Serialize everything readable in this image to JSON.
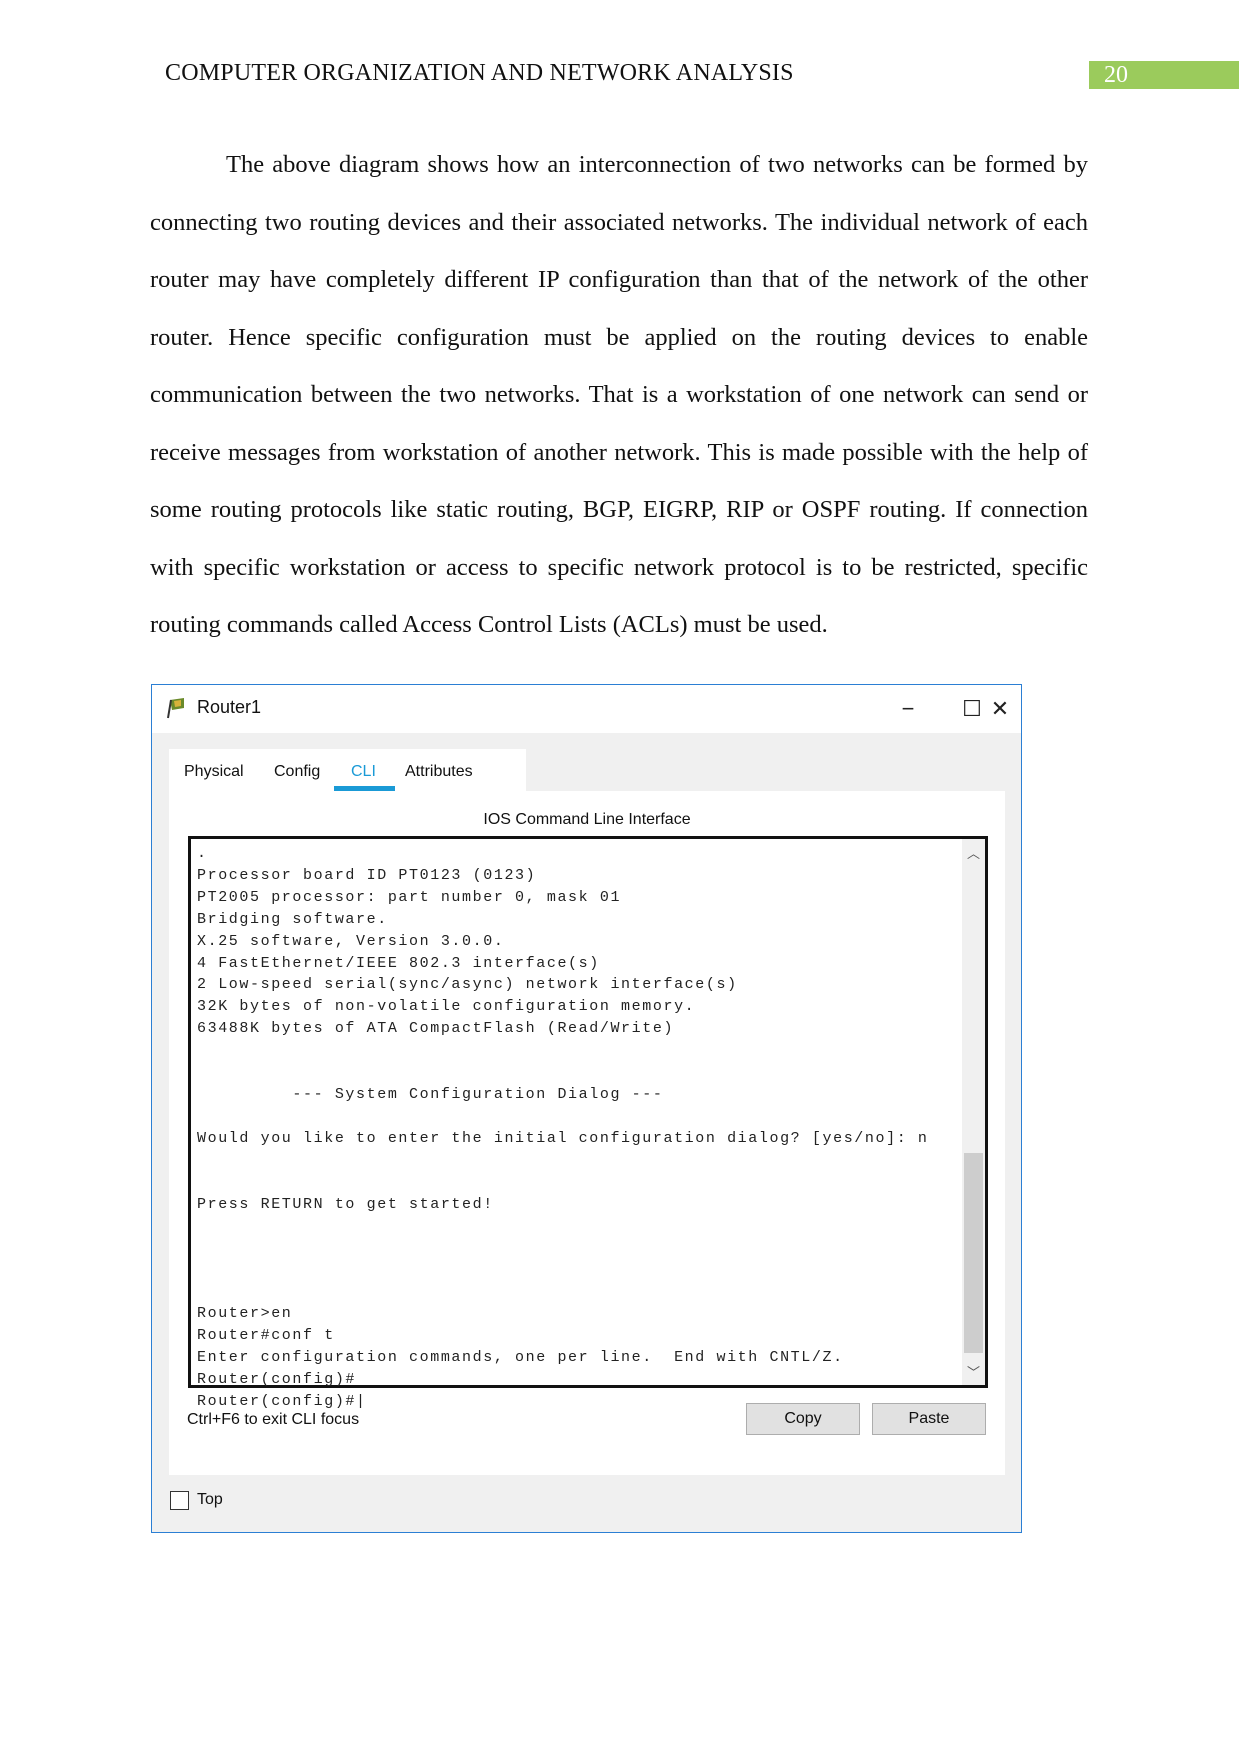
{
  "page": {
    "header": "COMPUTER ORGANIZATION AND NETWORK ANALYSIS",
    "page_number": "20",
    "paragraph": "The above diagram shows how an interconnection of two networks can be formed by connecting two routing devices and their associated networks. The individual network of each router may have completely different IP configuration than that of the network of the other router. Hence specific configuration must be applied on the routing devices to enable communication between the two networks. That is a workstation of one network can send or receive messages from workstation of another network. This is made possible with the help of some routing protocols like static routing, BGP, EIGRP, RIP or OSPF routing. If connection with specific workstation or access to specific network protocol is to be restricted, specific routing commands called Access Control Lists (ACLs) must be used."
  },
  "window": {
    "title": "Router1",
    "minimize": "−",
    "maximize": "☐",
    "close": "✕",
    "tabs": [
      {
        "label": "Physical"
      },
      {
        "label": "Config"
      },
      {
        "label": "CLI",
        "active": true
      },
      {
        "label": "Attributes"
      }
    ],
    "cli_title": "IOS Command Line Interface",
    "terminal": ".\nProcessor board ID PT0123 (0123)\nPT2005 processor: part number 0, mask 01\nBridging software.\nX.25 software, Version 3.0.0.\n4 FastEthernet/IEEE 802.3 interface(s)\n2 Low-speed serial(sync/async) network interface(s)\n32K bytes of non-volatile configuration memory.\n63488K bytes of ATA CompactFlash (Read/Write)\n\n\n         --- System Configuration Dialog ---\n\nWould you like to enter the initial configuration dialog? [yes/no]: n\n\n\nPress RETURN to get started!\n\n\n\n\nRouter>en\nRouter#conf t\nEnter configuration commands, one per line.  End with CNTL/Z.\nRouter(config)#\nRouter(config)#|",
    "hint": "Ctrl+F6 to exit CLI focus",
    "copy_label": "Copy",
    "paste_label": "Paste",
    "top_label": "Top",
    "top_checked": false,
    "accent": "#1a9ad6"
  }
}
